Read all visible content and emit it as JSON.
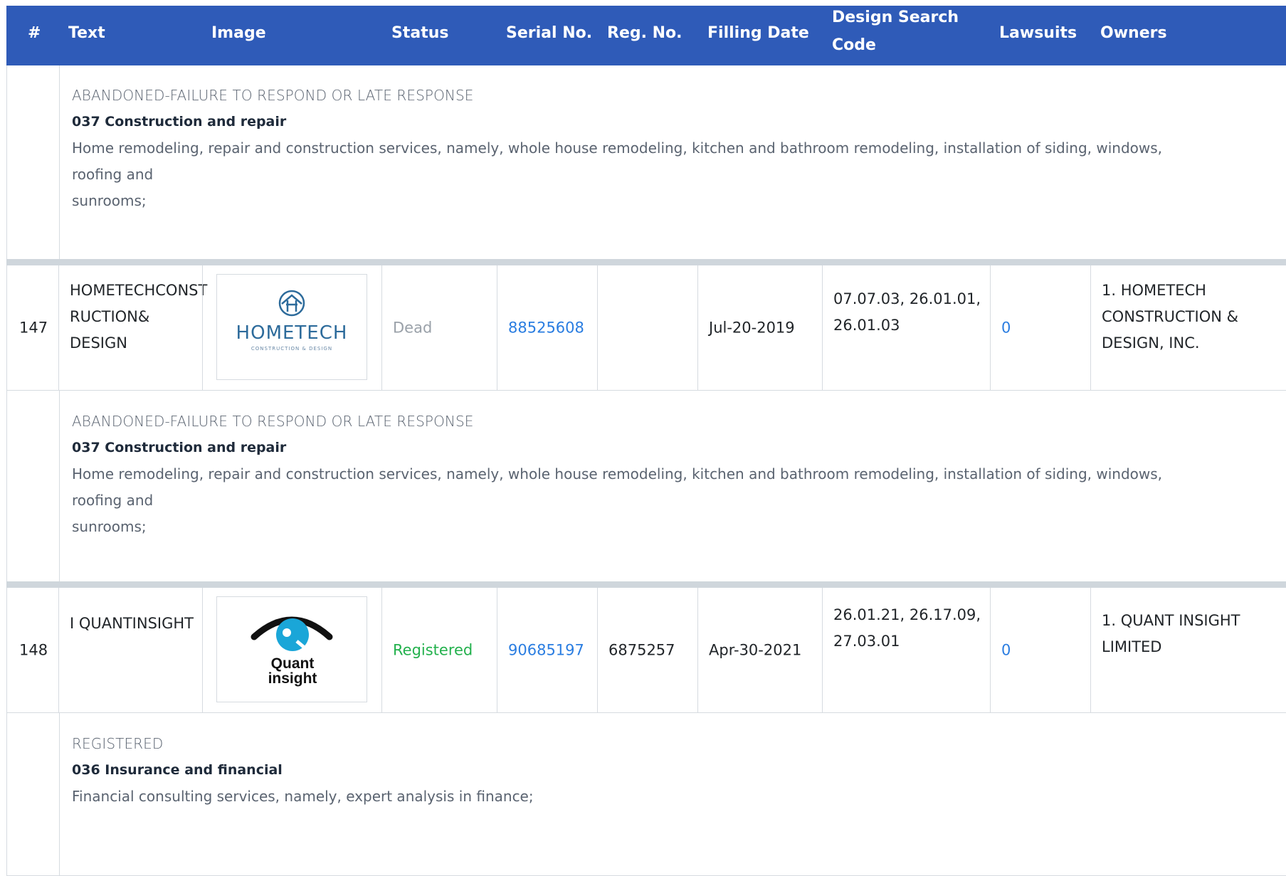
{
  "header": {
    "cols": [
      "#",
      "Text",
      "Image",
      "Status",
      "Serial No.",
      "Reg. No.",
      "Filling Date",
      "Design Search",
      "Code",
      "Lawsuits",
      "Owners"
    ]
  },
  "top_desc": {
    "status": "ABANDONED-FAILURE TO RESPOND OR LATE RESPONSE",
    "class": "037 Construction and repair",
    "desc_line1": "Home remodeling, repair and construction services, namely, whole house remodeling, kitchen and bathroom remodeling, installation of siding, windows, roofing and",
    "desc_line2": "sunrooms;"
  },
  "rows": [
    {
      "num": "147",
      "text_lines": [
        "HOMETECHCONST",
        "RUCTION&",
        "DESIGN"
      ],
      "logo": {
        "brand": "HOMETECH",
        "sub": "CONSTRUCTION & DESIGN",
        "icon": "house-logo-icon",
        "color": "#2d6b9b"
      },
      "status": "Dead",
      "serial": "88525608",
      "reg": "",
      "date": "Jul-20-2019",
      "codes_line1": "07.07.03, 26.01.01,",
      "codes_line2": "26.01.03",
      "lawsuits": "0",
      "owners_lines": [
        "1. HOMETECH",
        "CONSTRUCTION &",
        "DESIGN, INC."
      ],
      "desc": {
        "status": "ABANDONED-FAILURE TO RESPOND OR LATE RESPONSE",
        "class": "037 Construction and repair",
        "desc_line1": "Home remodeling, repair and construction services, namely, whole house remodeling, kitchen and bathroom remodeling, installation of siding, windows, roofing and",
        "desc_line2": "sunrooms;"
      }
    },
    {
      "num": "148",
      "text_lines": [
        "I QUANTINSIGHT"
      ],
      "logo": {
        "word1": "Quant",
        "word2": "insight",
        "icon": "eye-logo-icon",
        "color": "#1aa6d8"
      },
      "status": "Registered",
      "serial": "90685197",
      "reg": "6875257",
      "date": "Apr-30-2021",
      "codes_line1": "26.01.21, 26.17.09,",
      "codes_line2": "27.03.01",
      "lawsuits": "0",
      "owners_lines": [
        "1. QUANT INSIGHT",
        "LIMITED"
      ],
      "desc": {
        "status": "REGISTERED",
        "class": "036 Insurance and financial",
        "desc_line1": "Financial consulting services, namely, expert analysis in finance;",
        "desc_line2": ""
      }
    }
  ]
}
